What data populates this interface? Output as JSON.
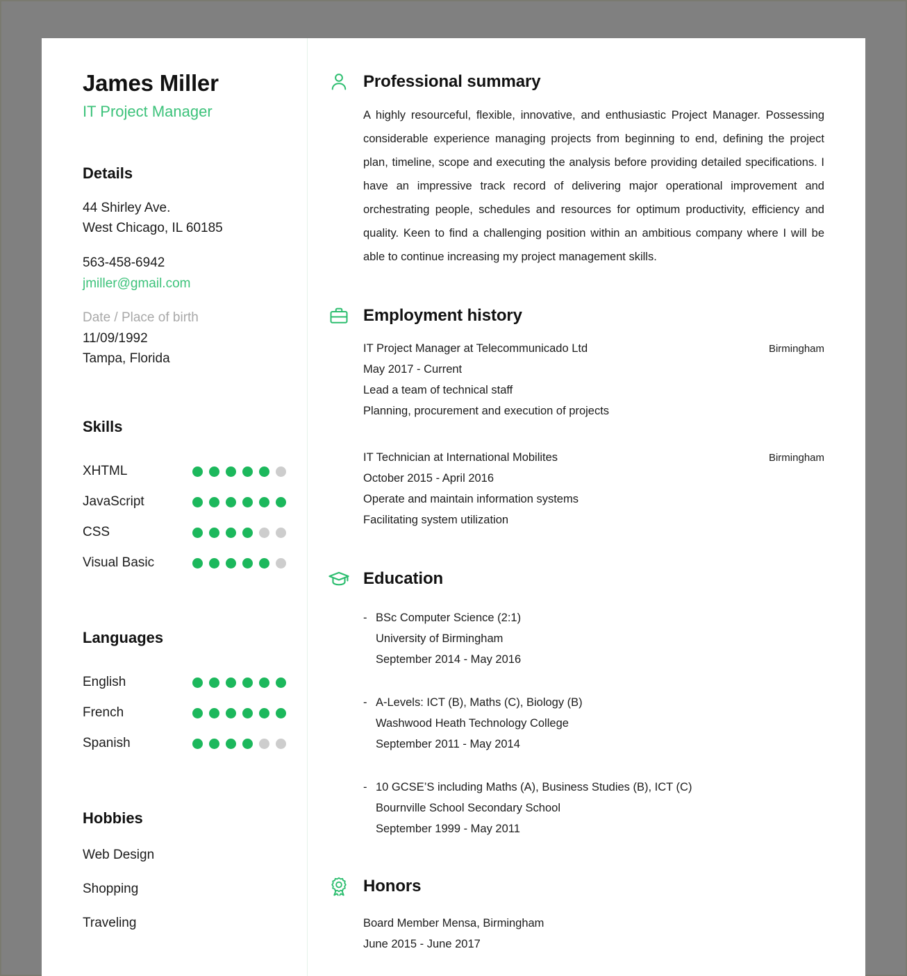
{
  "theme": {
    "accent_green": "#1cb85c",
    "title_green": "#3cc27a",
    "dot_empty": "#cdcdcd",
    "page_background": "#808080",
    "paper": "#ffffff",
    "text": "#1b1b1b",
    "muted": "#a8a8a8"
  },
  "header": {
    "name": "James Miller",
    "job_title": "IT Project Manager"
  },
  "sidebar": {
    "details": {
      "heading": "Details",
      "address_line1": "44 Shirley Ave.",
      "address_line2": "West Chicago, IL 60185",
      "phone": "563-458-6942",
      "email": "jmiller@gmail.com",
      "birth_label": "Date / Place of birth",
      "birth_date": "11/09/1992",
      "birth_place": "Tampa, Florida"
    },
    "skills": {
      "heading": "Skills",
      "max": 6,
      "items": [
        {
          "label": "XHTML",
          "level": 5
        },
        {
          "label": "JavaScript",
          "level": 6
        },
        {
          "label": "CSS",
          "level": 4
        },
        {
          "label": "Visual Basic",
          "level": 5
        }
      ]
    },
    "languages": {
      "heading": "Languages",
      "max": 6,
      "items": [
        {
          "label": "English",
          "level": 6
        },
        {
          "label": "French",
          "level": 6
        },
        {
          "label": "Spanish",
          "level": 4
        }
      ]
    },
    "hobbies": {
      "heading": "Hobbies",
      "items": [
        "Web Design",
        "Shopping",
        "Traveling"
      ]
    }
  },
  "main": {
    "summary": {
      "icon": "person-icon",
      "title": "Professional summary",
      "text": "A highly resourceful, flexible, innovative, and enthusiastic Project Manager. Possessing considerable experience managing projects from beginning to end, defining the project plan, timeline, scope and executing the analysis before providing detailed specifications. I have an impressive track record of delivering major operational improvement and orchestrating people, schedules and resources for optimum productivity, efficiency and quality. Keen to find a challenging position within an ambitious company where I will be able to continue increasing my project management skills."
    },
    "employment": {
      "icon": "briefcase-icon",
      "title": "Employment history",
      "jobs": [
        {
          "role": "IT Project Manager at Telecommunicado Ltd",
          "location": "Birmingham",
          "dates": "May 2017 - Current",
          "duty1": "Lead a team of technical staff",
          "duty2": "Planning, procurement and execution of projects"
        },
        {
          "role": "IT Technician at International Mobilites",
          "location": "Birmingham",
          "dates": "October 2015 - April 2016",
          "duty1": "Operate and maintain information systems",
          "duty2": "Facilitating system utilization"
        }
      ]
    },
    "education": {
      "icon": "graduation-cap-icon",
      "title": "Education",
      "bullet": "-",
      "entries": [
        {
          "qualification": "BSc Computer Science (2:1)",
          "institution": "University of Birmingham",
          "dates": "September 2014 - May 2016"
        },
        {
          "qualification": "A-Levels: ICT (B), Maths (C), Biology (B)",
          "institution": "Washwood Heath Technology College",
          "dates": "September 2011 - May 2014"
        },
        {
          "qualification": "10 GCSE’S including Maths (A), Business Studies (B), ICT (C)",
          "institution": "Bournville School Secondary School",
          "dates": "September 1999 - May 2011"
        }
      ]
    },
    "honors": {
      "icon": "award-ribbon-icon",
      "title": "Honors",
      "entry": "Board Member Mensa, Birmingham",
      "dates": "June 2015 - June 2017"
    }
  }
}
